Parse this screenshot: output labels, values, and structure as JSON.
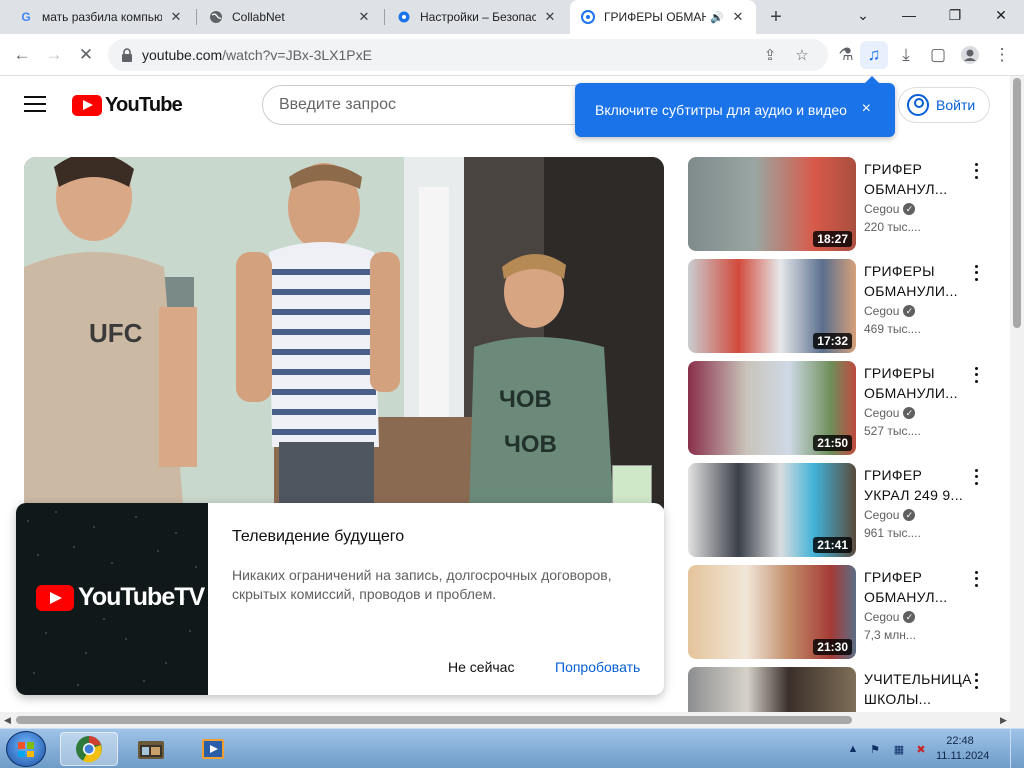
{
  "browser": {
    "tabs": [
      {
        "title": "мать разбила компьютер",
        "favicon": "google-g-icon"
      },
      {
        "title": "CollabNet",
        "favicon": "globe-icon"
      },
      {
        "title": "Настройки – Безопасность",
        "favicon": "gear-icon"
      },
      {
        "title": "ГРИФЕРЫ ОБМАНУЛИ",
        "favicon": "chrome-icon",
        "active": true
      }
    ],
    "url_host": "youtube.com",
    "url_path": "/watch?v=JBx-3LX1PxE"
  },
  "youtube": {
    "logo_text": "YouTube",
    "search_placeholder": "Введите запрос",
    "signin_label": "Войти",
    "caption_tip": "Включите субтитры для аудио и видео",
    "caption_tip_close": "×"
  },
  "related": [
    {
      "title_lines": [
        "ГРИФЕР",
        "ОБМАНУЛ..."
      ],
      "channel": "Cegou",
      "views": "220 тыс....",
      "duration": "18:27"
    },
    {
      "title_lines": [
        "ГРИФЕРЫ",
        "ОБМАНУЛИ..."
      ],
      "channel": "Cegou",
      "views": "469 тыс....",
      "duration": "17:32"
    },
    {
      "title_lines": [
        "ГРИФЕРЫ",
        "ОБМАНУЛИ..."
      ],
      "channel": "Cegou",
      "views": "527 тыс....",
      "duration": "21:50"
    },
    {
      "title_lines": [
        "ГРИФЕР",
        "УКРАЛ 249 9..."
      ],
      "channel": "Cegou",
      "views": "961 тыс....",
      "duration": "21:41"
    },
    {
      "title_lines": [
        "ГРИФЕР",
        "ОБМАНУЛ..."
      ],
      "channel": "Cegou",
      "views": "7,3 млн...",
      "duration": "21:30"
    },
    {
      "title_lines": [
        "УЧИТЕЛЬНИЦА",
        "ШКОЛЫ..."
      ],
      "channel": "",
      "views": "",
      "duration": ""
    }
  ],
  "promo": {
    "logo_text": "YouTubeTV",
    "title": "Телевидение будущего",
    "description": "Никаких ограничений на запись, долгосрочных договоров, скрытых комиссий, проводов и проблем.",
    "dismiss_label": "Не сейчас",
    "accept_label": "Попробовать"
  },
  "taskbar": {
    "time": "22:48",
    "date": "11.11.2024"
  },
  "colors": {
    "youtube_red": "#ff0000",
    "link_blue": "#065fd4",
    "tooltip_blue": "#1a73e8"
  }
}
